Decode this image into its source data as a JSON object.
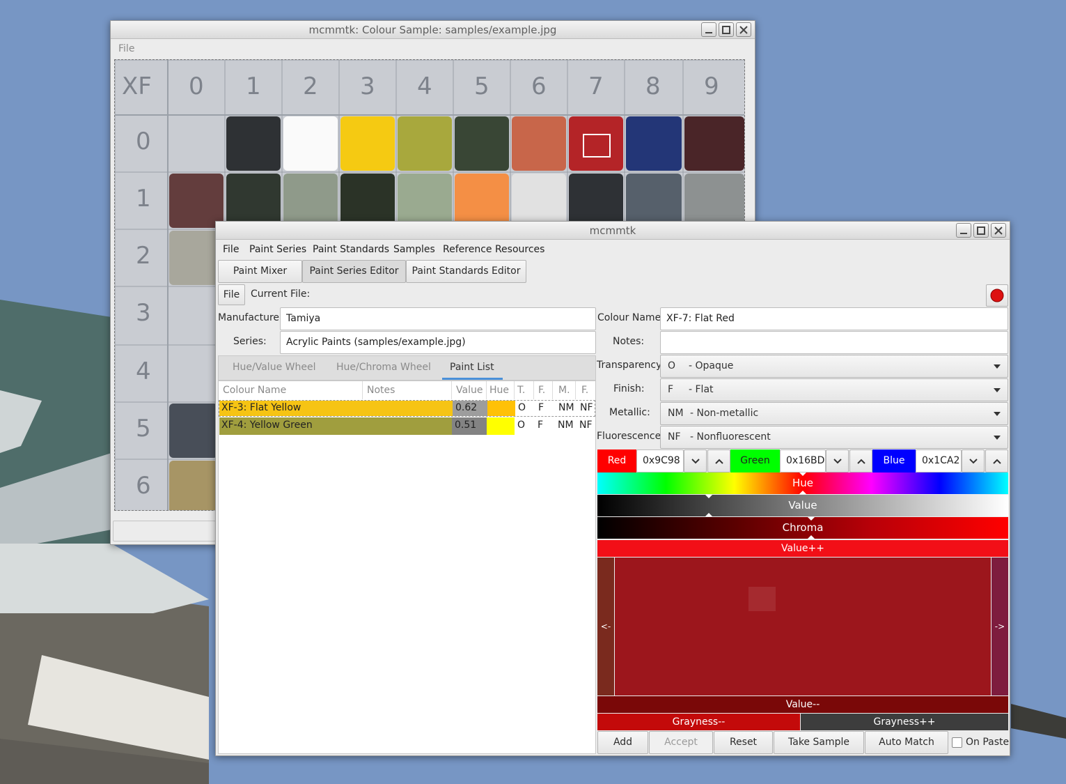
{
  "back_window": {
    "title": "mcmmtk: Colour Sample: samples/example.jpg",
    "menu_file": "File",
    "sheet": {
      "header_row": [
        "XF",
        "0",
        "1",
        "2",
        "3",
        "4",
        "5",
        "6",
        "7",
        "8",
        "9"
      ],
      "row_labels": [
        "0",
        "1",
        "2",
        "3",
        "4",
        "5",
        "6"
      ],
      "row0_swatches": [
        "#f5f5f5",
        "#2e3134",
        "#fafafa",
        "#f5ca12",
        "#a8a83d",
        "#394635",
        "#c8664a",
        "#b42427",
        "#233677",
        "#4a2528"
      ],
      "row1_swatches": [
        "#633d3d",
        "#303830",
        "#8f9a8a",
        "#2b3327",
        "#9aaa90",
        "#f48f45",
        "#e1e1e1",
        "#2e3135",
        "#56606b",
        "#8d9191"
      ],
      "col0_swatches": [
        "#a8a79c",
        "#aaaaaa",
        "#aaaaaa",
        "#484e58",
        "#a79565"
      ]
    }
  },
  "main_window": {
    "title": "mcmmtk",
    "menu": [
      "File",
      "Paint Series",
      "Paint Standards",
      "Samples",
      "Reference Resources"
    ],
    "tabs": [
      "Paint Mixer",
      "Paint Series Editor",
      "Paint Standards Editor"
    ],
    "sub_menu_file": "File",
    "current_file_label": "Current File:",
    "manufacturer_label": "Manufacturer:",
    "manufacturer_value": "Tamiya",
    "series_label": "Series:",
    "series_value": "Acrylic Paints (samples/example.jpg)",
    "view_tabs": [
      "Hue/Value Wheel",
      "Hue/Chroma Wheel",
      "Paint List"
    ],
    "columns": [
      "Colour Name",
      "Notes",
      "Value",
      "Hue",
      "T.",
      "F.",
      "M.",
      "F."
    ],
    "rows": [
      {
        "name": "XF-3: Flat Yellow",
        "notes": "",
        "value": "0.62",
        "t": "O",
        "f": "F",
        "m": "NM",
        "fl": "NF",
        "row_color": "#f6c414",
        "value_color": "#9d9d9d",
        "hue_color": "#ffc107"
      },
      {
        "name": "XF-4: Yellow Green",
        "notes": "",
        "value": "0.51",
        "t": "O",
        "f": "F",
        "m": "NM",
        "fl": "NF",
        "row_color": "#a09e3e",
        "value_color": "#838383",
        "hue_color": "#ffff00"
      }
    ],
    "colour_name_label": "Colour Name:",
    "colour_name_value": "XF-7: Flat Red",
    "notes_label": "Notes:",
    "notes_value": "",
    "transparency_label": "Transparency:",
    "transparency_code": "O",
    "transparency_value": "- Opaque",
    "finish_label": "Finish:",
    "finish_code": "F",
    "finish_value": "- Flat",
    "metallic_label": "Metallic:",
    "metallic_code": "NM",
    "metallic_value": "- Non-metallic",
    "fluorescence_label": "Fluorescence:",
    "fluorescence_code": "NF",
    "fluorescence_value": "- Nonfluorescent",
    "red_label": "Red",
    "red_value": "0x9C98",
    "green_label": "Green",
    "green_value": "0x16BD",
    "blue_label": "Blue",
    "blue_value": "0x1CA2",
    "hue_label": "Hue",
    "value_label": "Value",
    "chroma_label": "Chroma",
    "value_up_label": "Value++",
    "value_down_label": "Value--",
    "left_label": "<-",
    "right_label": "->",
    "grayness_down_label": "Grayness--",
    "grayness_up_label": "Grayness++",
    "buttons": {
      "add": "Add",
      "accept": "Accept",
      "reset": "Reset",
      "take_sample": "Take Sample",
      "auto_match": "Auto Match"
    },
    "on_paste_label": "On Paste",
    "on_paste_checked": false,
    "colors": {
      "current": "#9c161c",
      "target": "#a52a2f",
      "left_panel": "#7a2a1e",
      "right_panel": "#7e1c3e",
      "value_up": "#f20f17",
      "value_down": "#7a0808",
      "grayness_down": "#c30a0a",
      "grayness_up": "#3d3d3d",
      "record_button": "#dd1111"
    }
  }
}
